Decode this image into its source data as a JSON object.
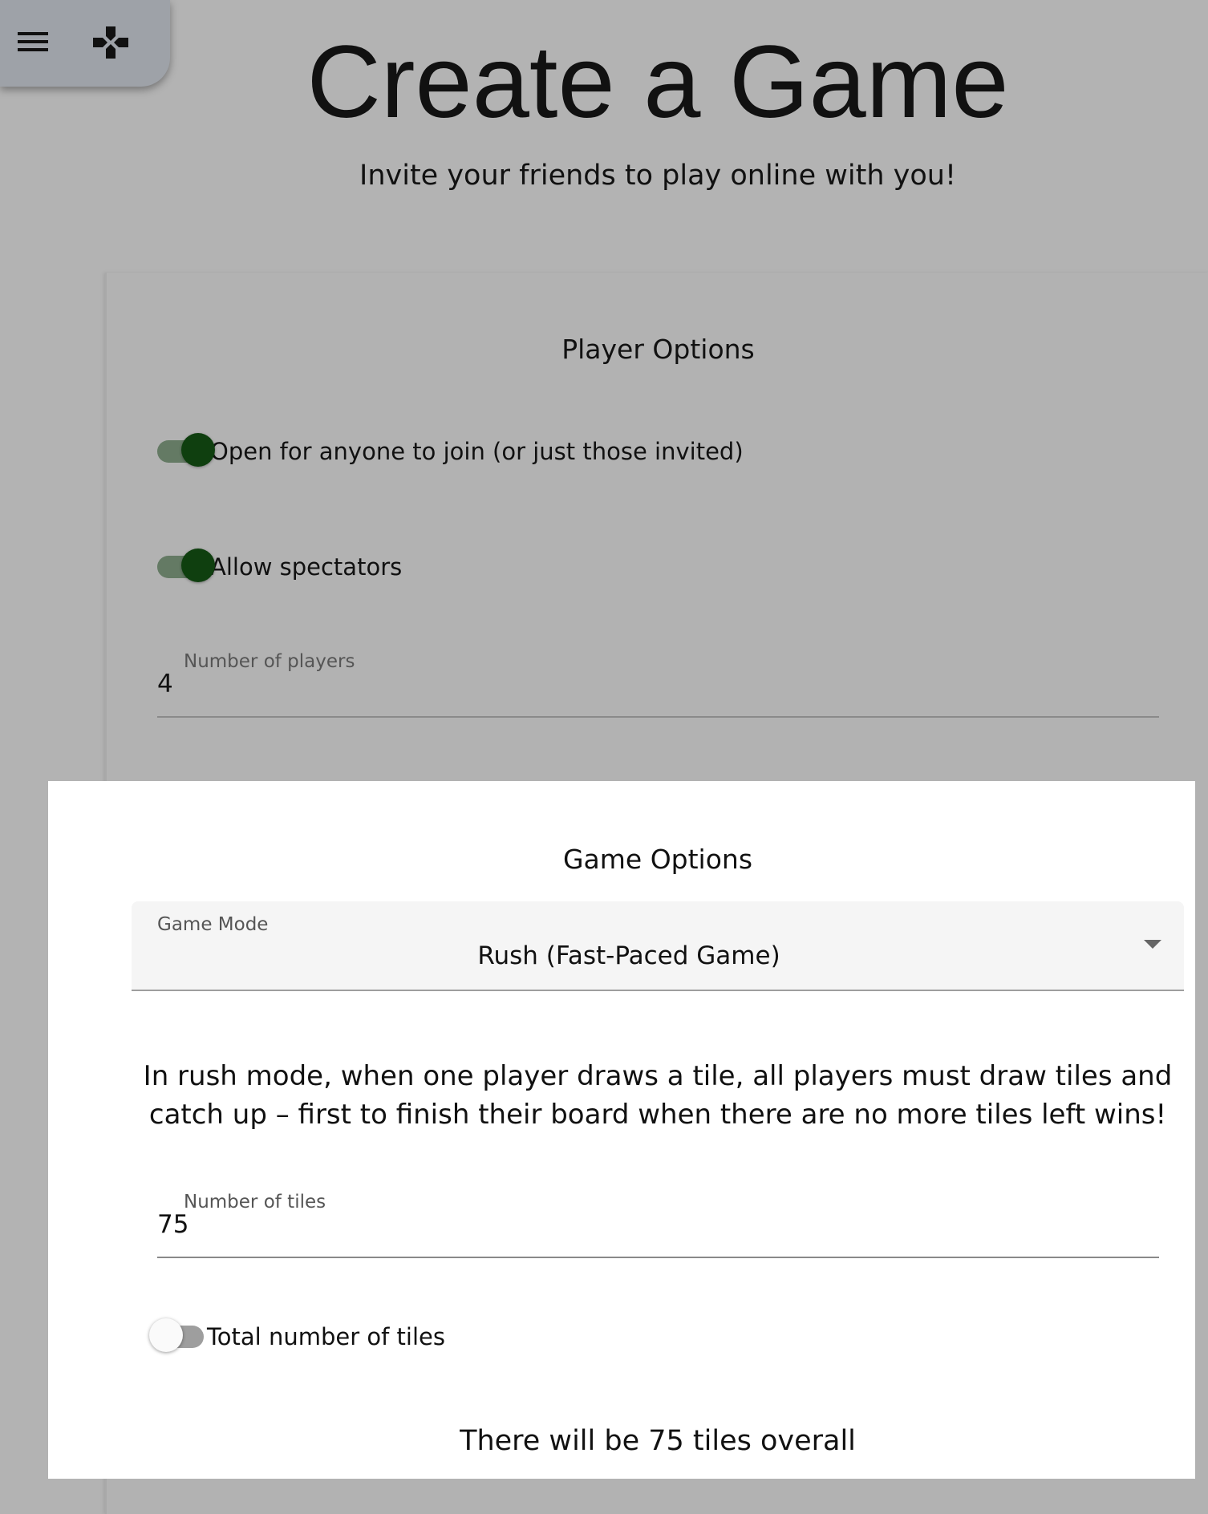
{
  "toolbar": {
    "menu_icon": "menu-icon",
    "game_icon": "gamepad-icon"
  },
  "header": {
    "title": "Create a Game",
    "subtitle": "Invite your friends to play online with you!"
  },
  "player_options": {
    "title": "Player Options",
    "open_to_anyone": {
      "label": "Open for anyone to join (or just those invited)",
      "checked": true
    },
    "allow_spectators": {
      "label": "Allow spectators",
      "checked": true
    },
    "number_of_players": {
      "label": "Number of players",
      "value": "4"
    }
  },
  "game_options": {
    "title": "Game Options",
    "game_mode": {
      "label": "Game Mode",
      "value": "Rush (Fast-Paced Game)"
    },
    "description": "In rush mode, when one player draws a tile, all players must draw tiles and catch up – first to finish their board when there are no more tiles left wins!",
    "number_of_tiles": {
      "label": "Number of tiles",
      "value": "75"
    },
    "total_tiles_toggle": {
      "label": "Total number of tiles",
      "checked": false
    },
    "summary": "There will be 75 tiles overall"
  },
  "colors": {
    "background": "#b3b3b3",
    "toggle_on_thumb": "#0f3f0f",
    "toggle_on_track": "#647a64",
    "card": "#ffffff"
  }
}
